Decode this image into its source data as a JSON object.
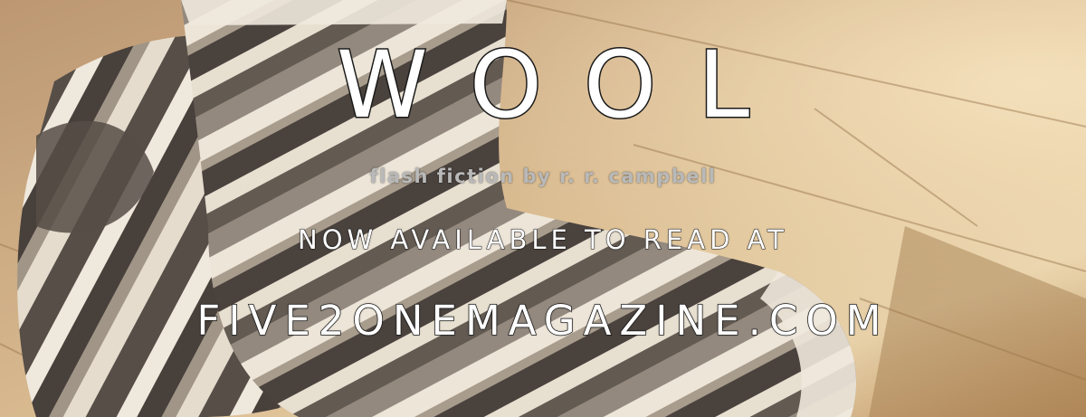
{
  "banner": {
    "title": "WOOL",
    "byline": "flash fiction by r. r. campbell",
    "availability": "NOW AVAILABLE TO READ AT",
    "website": "FIVE2ONEMAGAZINE.COM"
  },
  "background": {
    "subject": "striped-wool-socks-on-wood-floor",
    "colors": {
      "floor_light": "#d9b98b",
      "floor_dark": "#a77d4d",
      "stripe_dark": "#4a4039",
      "stripe_light": "#ede6da",
      "sock_mid": "#7c7268"
    }
  }
}
